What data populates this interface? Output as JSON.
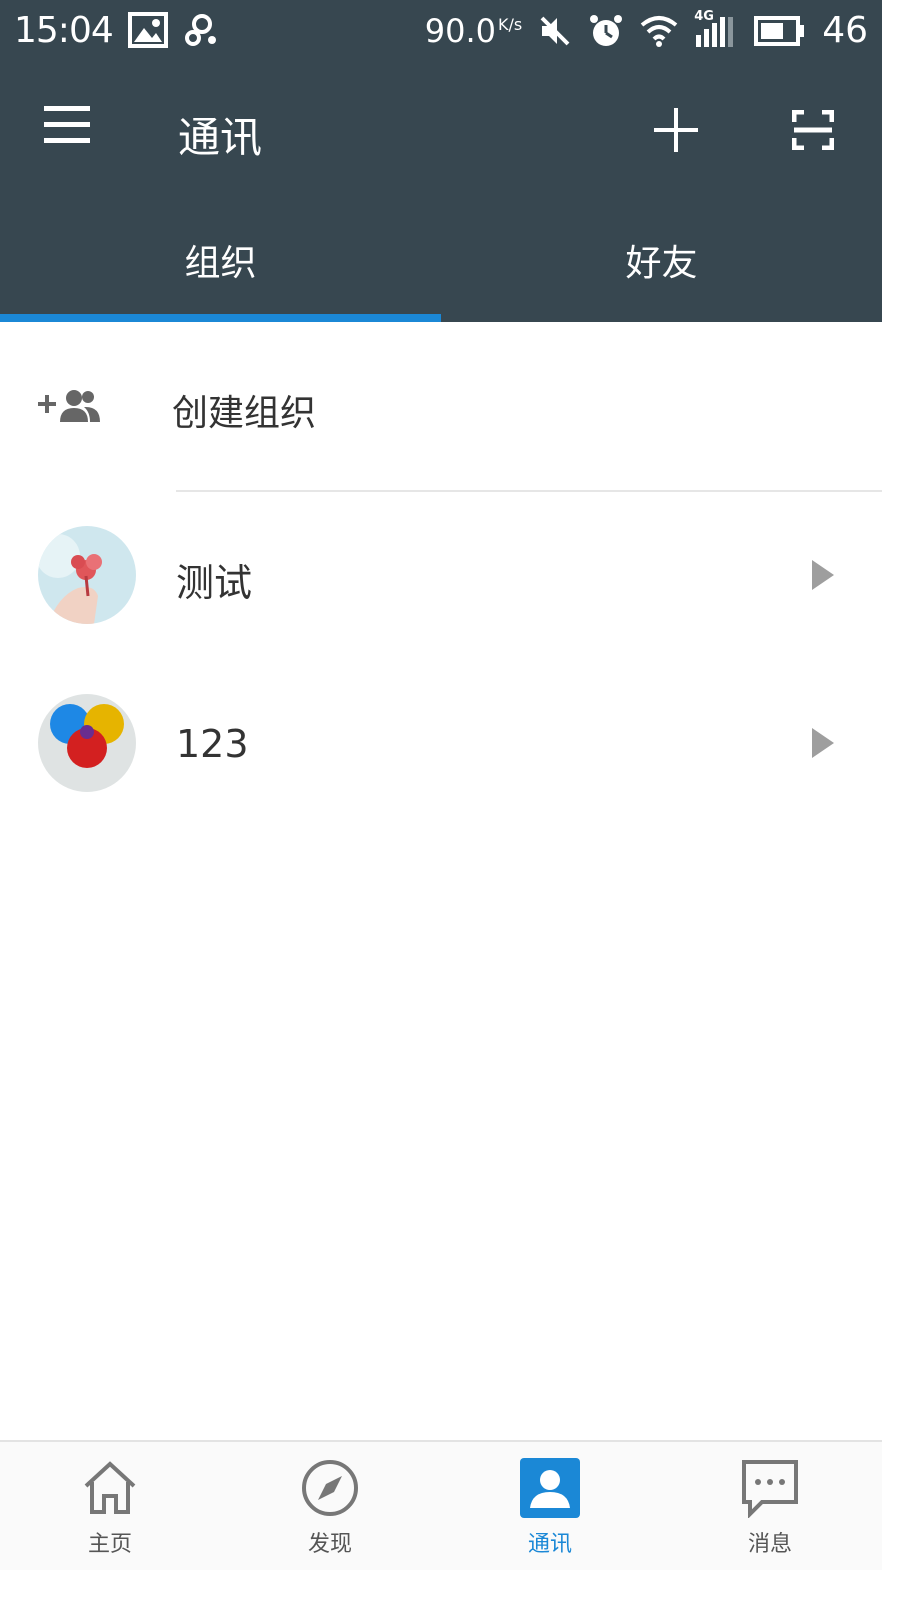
{
  "status_bar": {
    "time": "15:04",
    "net_speed": "90.0",
    "net_speed_unit": "K/s",
    "network_type": "4G",
    "battery_percent": "46"
  },
  "header": {
    "title": "通讯",
    "menu_icon": "menu-icon",
    "add_icon": "plus-icon",
    "scan_icon": "scan-icon"
  },
  "tabs": [
    {
      "label": "组织",
      "active": true
    },
    {
      "label": "好友",
      "active": false
    }
  ],
  "create_org": {
    "label": "创建组织",
    "icon": "add-group-icon"
  },
  "orgs": [
    {
      "name": "测试",
      "avatar": "flower-avatar"
    },
    {
      "name": "123",
      "avatar": "venn-avatar"
    }
  ],
  "bottom_nav": [
    {
      "label": "主页",
      "icon": "home-icon",
      "active": false
    },
    {
      "label": "发现",
      "icon": "compass-icon",
      "active": false
    },
    {
      "label": "通讯",
      "icon": "contact-icon",
      "active": true
    },
    {
      "label": "消息",
      "icon": "message-icon",
      "active": false
    }
  ],
  "colors": {
    "header_bg": "#374750",
    "accent": "#1b88d6",
    "chevron": "#9e9e9e"
  }
}
